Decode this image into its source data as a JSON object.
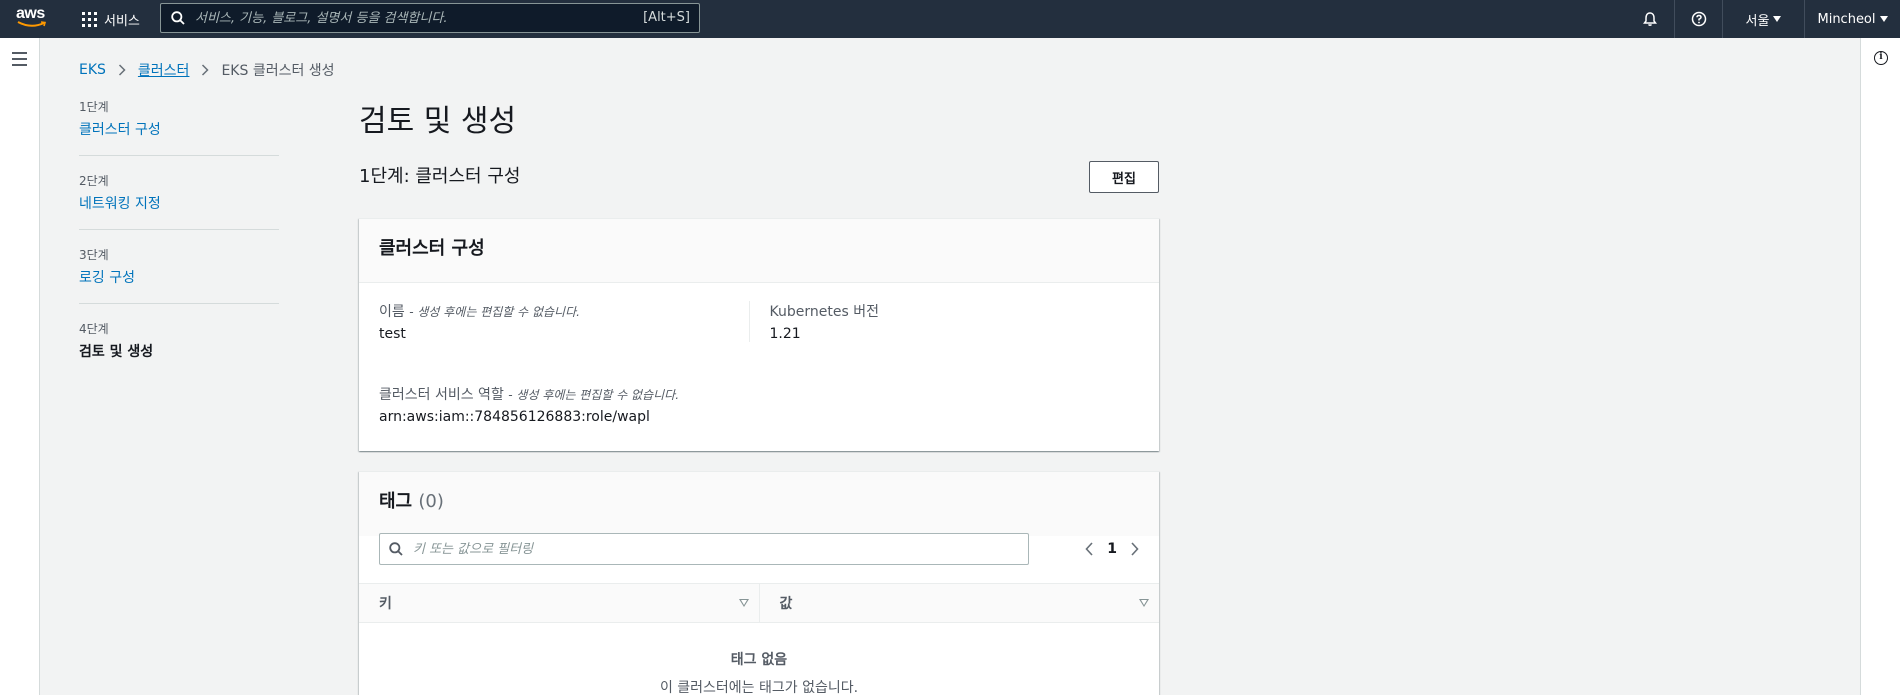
{
  "topnav": {
    "logo_text": "aws",
    "services_label": "서비스",
    "search_placeholder": "서비스, 기능, 블로그, 설명서 등을 검색합니다.",
    "search_shortcut": "[Alt+S]",
    "region": "서울",
    "account": "Mincheol"
  },
  "breadcrumb": [
    {
      "label": "EKS"
    },
    {
      "label": "클러스터"
    },
    {
      "label": "EKS 클러스터 생성"
    }
  ],
  "steps": [
    {
      "num": "1단계",
      "label": "클러스터 구성"
    },
    {
      "num": "2단계",
      "label": "네트워킹 지정"
    },
    {
      "num": "3단계",
      "label": "로깅 구성"
    },
    {
      "num": "4단계",
      "label": "검토 및 생성"
    }
  ],
  "main": {
    "page_title": "검토 및 생성",
    "section_title": "1단계: 클러스터 구성",
    "edit_label": "편집"
  },
  "cluster_card": {
    "title": "클러스터 구성",
    "name_label": "이름",
    "name_hint": "- 생성 후에는 편집할 수 없습니다.",
    "name_value": "test",
    "k8s_label": "Kubernetes 버전",
    "k8s_value": "1.21",
    "role_label": "클러스터 서비스 역할",
    "role_hint": "- 생성 후에는 편집할 수 없습니다.",
    "role_value": "arn:aws:iam::784856126883:role/wapl"
  },
  "tags_card": {
    "title": "태그",
    "count": "(0)",
    "filter_placeholder": "키 또는 값으로 필터링",
    "page": "1",
    "col_key": "키",
    "col_value": "값",
    "empty_title": "태그 없음",
    "empty_desc": "이 클러스터에는 태그가 없습니다."
  },
  "colors": {
    "nav_bg": "#232f3e",
    "link": "#0073bb",
    "page_bg": "#f2f3f3"
  }
}
